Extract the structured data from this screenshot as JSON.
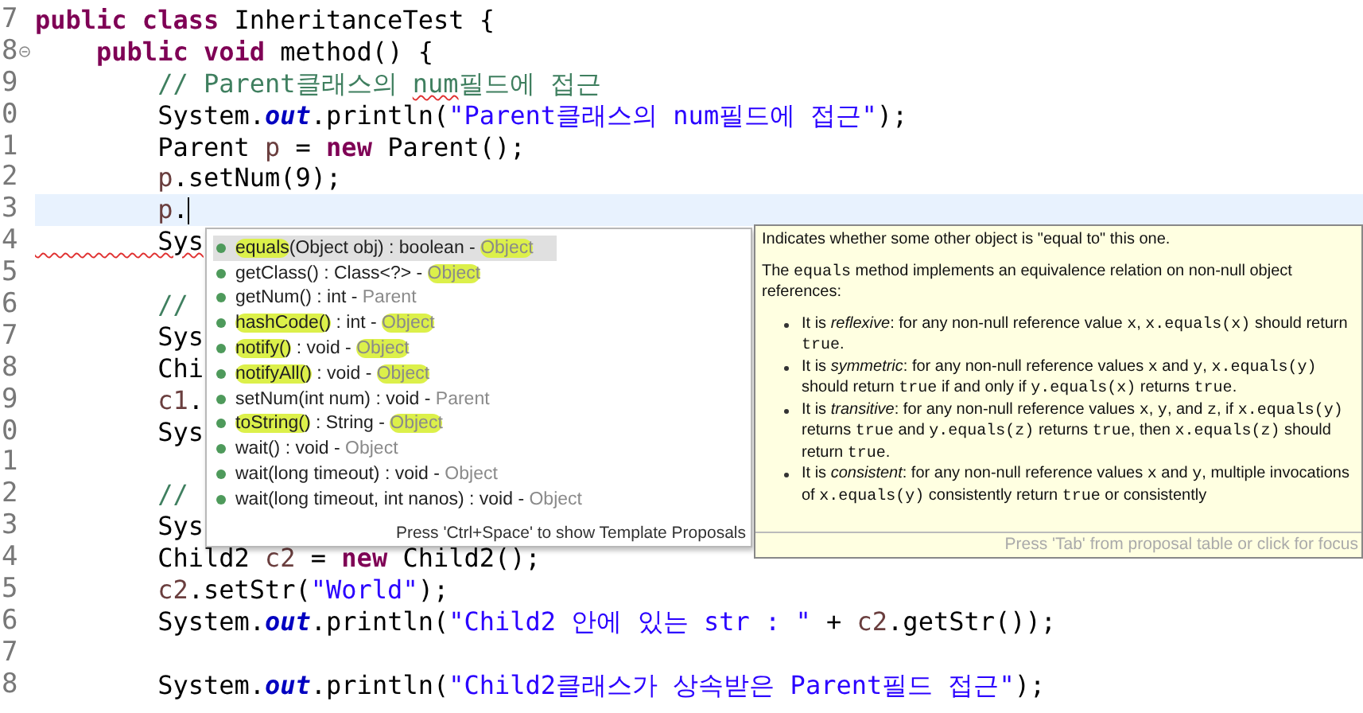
{
  "editor": {
    "lines": [
      {
        "number": "7",
        "current": false,
        "fold": false,
        "tokens": [
          {
            "kind": "keyword",
            "text": "public class"
          },
          {
            "kind": "plain",
            "text": " InheritanceTest {"
          }
        ]
      },
      {
        "number": "8",
        "current": false,
        "fold": true,
        "tokens": [
          {
            "kind": "keyword",
            "text": "    public void"
          },
          {
            "kind": "plain",
            "text": " method() {"
          }
        ]
      },
      {
        "number": "9",
        "current": false,
        "fold": false,
        "tokens": [
          {
            "kind": "comment",
            "text": "        // Parent클래스의 "
          },
          {
            "kind": "comment-misspelled",
            "text": "num"
          },
          {
            "kind": "comment",
            "text": "필드에 접근"
          }
        ]
      },
      {
        "number": "0",
        "current": false,
        "fold": false,
        "tokens": [
          {
            "kind": "plain",
            "text": "        System."
          },
          {
            "kind": "field",
            "text": "out"
          },
          {
            "kind": "plain",
            "text": ".println("
          },
          {
            "kind": "string",
            "text": "\"Parent클래스의 num필드에 접근\""
          },
          {
            "kind": "plain",
            "text": ");"
          }
        ]
      },
      {
        "number": "1",
        "current": false,
        "fold": false,
        "tokens": [
          {
            "kind": "plain",
            "text": "        Parent "
          },
          {
            "kind": "variable",
            "text": "p"
          },
          {
            "kind": "plain",
            "text": " = "
          },
          {
            "kind": "keyword",
            "text": "new"
          },
          {
            "kind": "plain",
            "text": " Parent();"
          }
        ]
      },
      {
        "number": "2",
        "current": false,
        "fold": false,
        "tokens": [
          {
            "kind": "variable",
            "text": "        p"
          },
          {
            "kind": "plain",
            "text": ".setNum(9);"
          }
        ]
      },
      {
        "number": "3",
        "current": true,
        "fold": false,
        "tokens": [
          {
            "kind": "variable",
            "text": "        p"
          },
          {
            "kind": "plain",
            "text": "."
          }
        ]
      },
      {
        "number": "4",
        "current": false,
        "fold": false,
        "tokens": [
          {
            "kind": "error",
            "text": "        Sys"
          }
        ]
      },
      {
        "number": "5",
        "current": false,
        "fold": false
      },
      {
        "number": "6",
        "current": false,
        "fold": false,
        "tokens": [
          {
            "kind": "comment",
            "text": "        //"
          }
        ]
      },
      {
        "number": "7",
        "current": false,
        "fold": false,
        "tokens": [
          {
            "kind": "plain",
            "text": "        Sys"
          }
        ]
      },
      {
        "number": "8",
        "current": false,
        "fold": false,
        "tokens": [
          {
            "kind": "plain",
            "text": "        Chi"
          }
        ]
      },
      {
        "number": "9",
        "current": false,
        "fold": false,
        "tokens": [
          {
            "kind": "variable",
            "text": "        c1"
          },
          {
            "kind": "plain",
            "text": "."
          }
        ]
      },
      {
        "number": "0",
        "current": false,
        "fold": false,
        "tokens": [
          {
            "kind": "plain",
            "text": "        Sys"
          }
        ]
      },
      {
        "number": "1",
        "current": false,
        "fold": false
      },
      {
        "number": "2",
        "current": false,
        "fold": false,
        "tokens": [
          {
            "kind": "comment",
            "text": "        //"
          }
        ]
      },
      {
        "number": "3",
        "current": false,
        "fold": false,
        "tokens": [
          {
            "kind": "plain",
            "text": "        Sys"
          }
        ]
      },
      {
        "number": "4",
        "current": false,
        "fold": false,
        "tokens": [
          {
            "kind": "plain",
            "text": "        Child2 "
          },
          {
            "kind": "variable",
            "text": "c2"
          },
          {
            "kind": "plain",
            "text": " = "
          },
          {
            "kind": "keyword",
            "text": "new"
          },
          {
            "kind": "plain",
            "text": " Child2();"
          }
        ]
      },
      {
        "number": "5",
        "current": false,
        "fold": false,
        "tokens": [
          {
            "kind": "variable",
            "text": "        c2"
          },
          {
            "kind": "plain",
            "text": ".setStr("
          },
          {
            "kind": "string",
            "text": "\"World\""
          },
          {
            "kind": "plain",
            "text": ");"
          }
        ]
      },
      {
        "number": "6",
        "current": false,
        "fold": false,
        "tokens": [
          {
            "kind": "plain",
            "text": "        System."
          },
          {
            "kind": "field",
            "text": "out"
          },
          {
            "kind": "plain",
            "text": ".println("
          },
          {
            "kind": "string",
            "text": "\"Child2 안에 있는 str : \""
          },
          {
            "kind": "plain",
            "text": " + "
          },
          {
            "kind": "variable",
            "text": "c2"
          },
          {
            "kind": "plain",
            "text": ".getStr());"
          }
        ]
      },
      {
        "number": "7",
        "current": false,
        "fold": false
      },
      {
        "number": "8",
        "current": false,
        "fold": false,
        "tokens": [
          {
            "kind": "plain",
            "text": "        System."
          },
          {
            "kind": "field",
            "text": "out"
          },
          {
            "kind": "plain",
            "text": ".println("
          },
          {
            "kind": "string",
            "text": "\"Child2클래스가 상속받은 Parent필드 접근\""
          },
          {
            "kind": "plain",
            "text": ");"
          }
        ]
      }
    ]
  },
  "proposals": {
    "items": [
      {
        "name": "equals",
        "rest": "(Object obj) : boolean - ",
        "owner": "Object",
        "selected": true,
        "name_marked": true,
        "owner_marked": true
      },
      {
        "name": "getClass()",
        "rest": " : Class<?> - ",
        "owner": "Object",
        "selected": false,
        "name_marked": false,
        "owner_marked": true
      },
      {
        "name": "getNum()",
        "rest": " : int - ",
        "owner": "Parent",
        "selected": false,
        "name_marked": false,
        "owner_marked": false
      },
      {
        "name": "hashCode()",
        "rest": " : int - ",
        "owner": "Object",
        "selected": false,
        "name_marked": true,
        "owner_marked": true
      },
      {
        "name": "notify()",
        "rest": " : void - ",
        "owner": "Object",
        "selected": false,
        "name_marked": true,
        "owner_marked": true
      },
      {
        "name": "notifyAll()",
        "rest": " : void - ",
        "owner": "Object",
        "selected": false,
        "name_marked": true,
        "owner_marked": true
      },
      {
        "name": "setNum(int num)",
        "rest": " : void - ",
        "owner": "Parent",
        "selected": false,
        "name_marked": false,
        "owner_marked": false
      },
      {
        "name": "toString()",
        "rest": " : String - ",
        "owner": "Object",
        "selected": false,
        "name_marked": true,
        "owner_marked": true
      },
      {
        "name": "wait()",
        "rest": " : void - ",
        "owner": "Object",
        "selected": false,
        "name_marked": false,
        "owner_marked": false
      },
      {
        "name": "wait(long timeout)",
        "rest": " : void - ",
        "owner": "Object",
        "selected": false,
        "name_marked": false,
        "owner_marked": false
      },
      {
        "name": "wait(long timeout, int nanos)",
        "rest": " : void - ",
        "owner": "Object",
        "selected": false,
        "name_marked": false,
        "owner_marked": false
      }
    ],
    "footer": "Press 'Ctrl+Space' to show Template Proposals"
  },
  "documentation": {
    "paragraphs": [
      [
        {
          "kind": "text",
          "text": "Indicates whether some other object is \"equal to\" this one."
        }
      ],
      [
        {
          "kind": "text",
          "text": "The "
        },
        {
          "kind": "code",
          "text": "equals"
        },
        {
          "kind": "text",
          "text": " method implements an equivalence relation on non-null object references:"
        }
      ]
    ],
    "bullets": [
      [
        {
          "kind": "text",
          "text": "It is "
        },
        {
          "kind": "em",
          "text": "reflexive"
        },
        {
          "kind": "text",
          "text": ": for any non-null reference value "
        },
        {
          "kind": "code",
          "text": "x"
        },
        {
          "kind": "text",
          "text": ", "
        },
        {
          "kind": "code",
          "text": "x.equals(x)"
        },
        {
          "kind": "text",
          "text": " should return "
        },
        {
          "kind": "code",
          "text": "true"
        },
        {
          "kind": "text",
          "text": "."
        }
      ],
      [
        {
          "kind": "text",
          "text": "It is "
        },
        {
          "kind": "em",
          "text": "symmetric"
        },
        {
          "kind": "text",
          "text": ": for any non-null reference values "
        },
        {
          "kind": "code",
          "text": "x"
        },
        {
          "kind": "text",
          "text": " and "
        },
        {
          "kind": "code",
          "text": "y"
        },
        {
          "kind": "text",
          "text": ", "
        },
        {
          "kind": "code",
          "text": "x.equals(y)"
        },
        {
          "kind": "text",
          "text": " should return "
        },
        {
          "kind": "code",
          "text": "true"
        },
        {
          "kind": "text",
          "text": " if and only if "
        },
        {
          "kind": "code",
          "text": "y.equals(x)"
        },
        {
          "kind": "text",
          "text": " returns "
        },
        {
          "kind": "code",
          "text": "true"
        },
        {
          "kind": "text",
          "text": "."
        }
      ],
      [
        {
          "kind": "text",
          "text": "It is "
        },
        {
          "kind": "em",
          "text": "transitive"
        },
        {
          "kind": "text",
          "text": ": for any non-null reference values "
        },
        {
          "kind": "code",
          "text": "x"
        },
        {
          "kind": "text",
          "text": ", "
        },
        {
          "kind": "code",
          "text": "y"
        },
        {
          "kind": "text",
          "text": ", and "
        },
        {
          "kind": "code",
          "text": "z"
        },
        {
          "kind": "text",
          "text": ", if "
        },
        {
          "kind": "code",
          "text": "x.equals(y)"
        },
        {
          "kind": "text",
          "text": " returns "
        },
        {
          "kind": "code",
          "text": "true"
        },
        {
          "kind": "text",
          "text": " and "
        },
        {
          "kind": "code",
          "text": "y.equals(z)"
        },
        {
          "kind": "text",
          "text": " returns "
        },
        {
          "kind": "code",
          "text": "true"
        },
        {
          "kind": "text",
          "text": ", then "
        },
        {
          "kind": "code",
          "text": "x.equals(z)"
        },
        {
          "kind": "text",
          "text": " should return "
        },
        {
          "kind": "code",
          "text": "true"
        },
        {
          "kind": "text",
          "text": "."
        }
      ],
      [
        {
          "kind": "text",
          "text": "It is "
        },
        {
          "kind": "em",
          "text": "consistent"
        },
        {
          "kind": "text",
          "text": ": for any non-null reference values "
        },
        {
          "kind": "code",
          "text": "x"
        },
        {
          "kind": "text",
          "text": " and "
        },
        {
          "kind": "code",
          "text": "y"
        },
        {
          "kind": "text",
          "text": ", multiple invocations of "
        },
        {
          "kind": "code",
          "text": "x.equals(y)"
        },
        {
          "kind": "text",
          "text": " consistently return "
        },
        {
          "kind": "code",
          "text": "true"
        },
        {
          "kind": "text",
          "text": " or consistently"
        }
      ]
    ],
    "footer": "Press 'Tab' from proposal table or click for focus"
  }
}
